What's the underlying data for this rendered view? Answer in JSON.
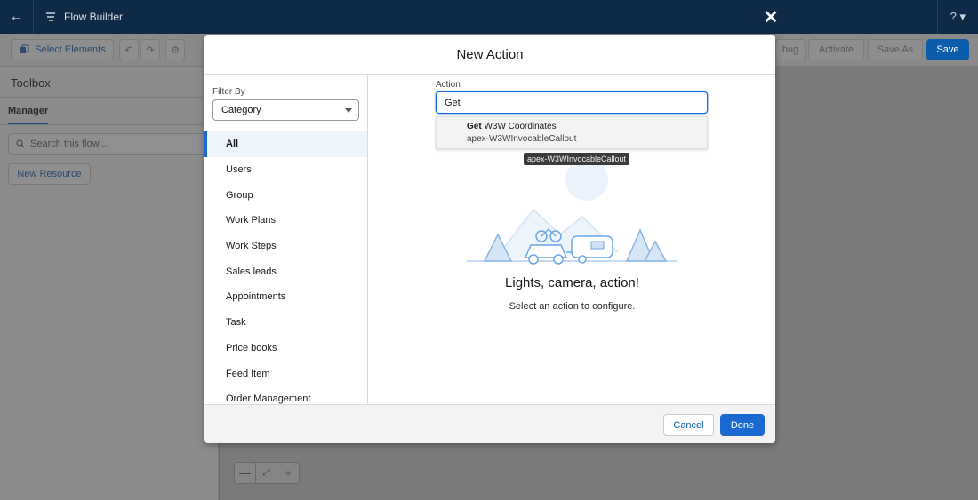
{
  "topbar": {
    "title": "Flow Builder",
    "help_label": "?",
    "back_icon": "back-arrow-icon",
    "close_icon": "close-icon"
  },
  "toolbar": {
    "select_elements": "Select Elements",
    "debug": "bug",
    "activate": "Activate",
    "save_as": "Save As",
    "save": "Save"
  },
  "toolbox": {
    "title": "Toolbox",
    "tab_manager": "Manager",
    "search_placeholder": "Search this flow...",
    "new_resource": "New Resource"
  },
  "modal": {
    "title": "New Action",
    "filter_label": "Filter By",
    "filter_value": "Category",
    "categories": [
      {
        "label": "All",
        "active": true
      },
      {
        "label": "Users"
      },
      {
        "label": "Group"
      },
      {
        "label": "Work Plans"
      },
      {
        "label": "Work Steps"
      },
      {
        "label": "Sales leads"
      },
      {
        "label": "Appointments"
      },
      {
        "label": "Task"
      },
      {
        "label": "Price books"
      },
      {
        "label": "Feed Item"
      },
      {
        "label": "Order Management"
      }
    ],
    "action_label": "Action",
    "action_value": "Get",
    "suggestion": {
      "match": "Get",
      "rest": " W3W Coordinates",
      "subtitle": "apex-W3WInvocableCallout"
    },
    "tooltip": "apex-W3WInvocableCallout",
    "empty_title": "Lights, camera, action!",
    "empty_subtitle": "Select an action to configure.",
    "cancel": "Cancel",
    "done": "Done"
  },
  "colors": {
    "brand": "#0b5cab",
    "accent": "#1b6ad1",
    "topbar": "#0e2a47"
  }
}
